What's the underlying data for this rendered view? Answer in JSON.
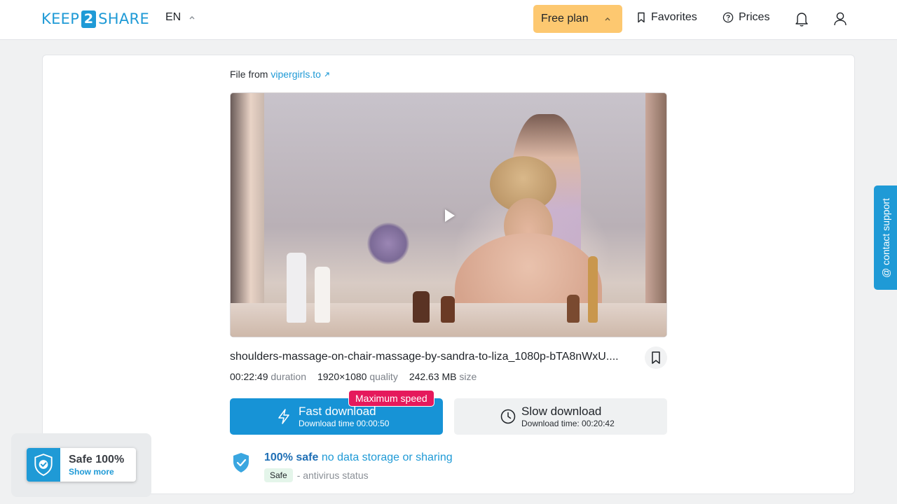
{
  "header": {
    "logo_left": "KEEP",
    "logo_mid": "2",
    "logo_right": "SHARE",
    "language": "EN",
    "plan_label": "Free plan",
    "favorites_label": "Favorites",
    "prices_label": "Prices"
  },
  "file": {
    "from_label": "File from",
    "source_link": "vipergirls.to",
    "name": "shoulders-massage-on-chair-massage-by-sandra-to-liza_1080p-bTA8nWxU....",
    "duration_value": "00:22:49",
    "duration_label": "duration",
    "quality_value": "1920×1080",
    "quality_label": "quality",
    "size_value": "242.63 MB",
    "size_label": "size"
  },
  "downloads": {
    "badge": "Maximum speed",
    "fast_label": "Fast download",
    "fast_time": "Download time 00:00:50",
    "slow_label": "Slow download",
    "slow_time": "Download time: 00:20:42"
  },
  "safety": {
    "title_bold": "100% safe",
    "title_rest": "no data storage or sharing",
    "status_pill": "Safe",
    "status_text": "- antivirus status"
  },
  "support_tab": "@ contact support",
  "safe_widget": {
    "title": "Safe 100%",
    "link": "Show more"
  },
  "colors": {
    "brand_blue": "#1f9ad6",
    "plan_yellow": "#fdc870",
    "badge_pink": "#e5195c",
    "safe_green": "#e4f5ea"
  },
  "icons": [
    "chevron-up-icon",
    "bookmark-icon",
    "question-circle-icon",
    "bell-icon",
    "user-icon",
    "external-link-icon",
    "play-icon",
    "lightning-icon",
    "clock-icon",
    "shield-check-icon"
  ]
}
